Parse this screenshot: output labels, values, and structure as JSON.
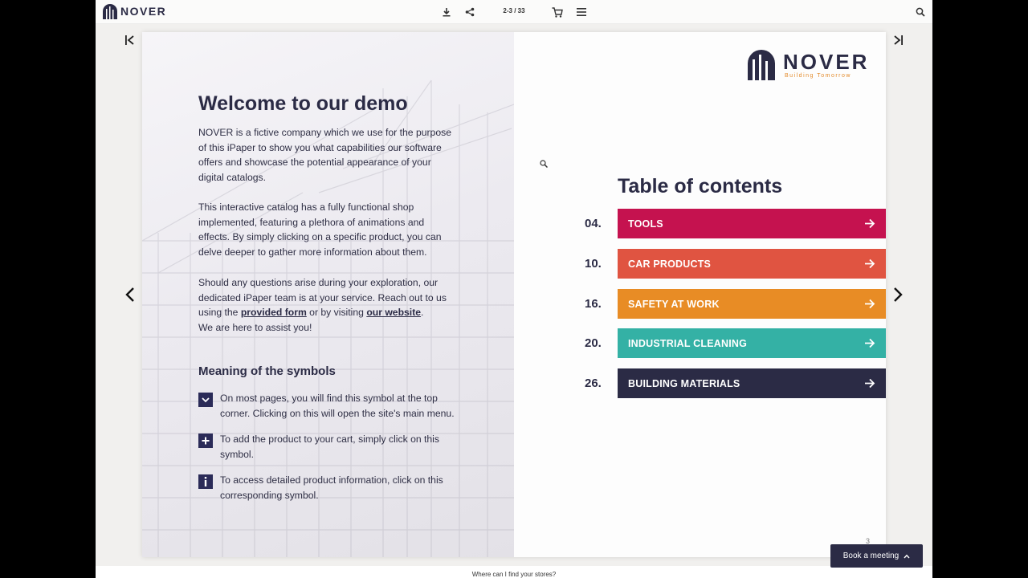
{
  "header": {
    "logo_text": "NOVER",
    "page_indicator": "2-3 / 33"
  },
  "left_page": {
    "title": "Welcome to our demo",
    "para1": "NOVER is a fictive company which we use for the purpose of this iPaper to show you what capabilities our software offers and showcase the potential appearance of your digital catalogs.",
    "para2": "This interactive catalog has a fully functional shop implemented, featuring a plethora of animations and effects. By simply clicking on a specific product, you can delve deeper to gather more information about them.",
    "para3_start": "Should any questions arise during your exploration, our dedicated iPaper team is at your service. Reach out to us using the ",
    "para3_link1": "provided form",
    "para3_mid": " or by visiting ",
    "para3_link2": "our website",
    "para3_end": ".",
    "para3_last": "We are here to assist you!",
    "symbols_title": "Meaning of the symbols",
    "symbols": [
      {
        "icon": "chevron-down-icon",
        "text": "On most pages, you will find this symbol at the top corner. Clicking on this will open the site's main menu."
      },
      {
        "icon": "plus-icon",
        "text": "To add the product to your cart, simply click on this symbol."
      },
      {
        "icon": "info-icon",
        "text": "To access detailed product information, click on this corresponding symbol."
      }
    ]
  },
  "right_page": {
    "logo_text": "NOVER",
    "logo_tagline": "Building Tomorrow",
    "toc_title": "Table of contents",
    "toc": [
      {
        "num": "04.",
        "label": "TOOLS",
        "color": "#c5124f"
      },
      {
        "num": "10.",
        "label": "CAR PRODUCTS",
        "color": "#e05441"
      },
      {
        "num": "16.",
        "label": "SAFETY AT WORK",
        "color": "#e88c25"
      },
      {
        "num": "20.",
        "label": "INDUSTRIAL CLEANING",
        "color": "#34b1a5"
      },
      {
        "num": "26.",
        "label": "BUILDING MATERIALS",
        "color": "#2b2b45"
      }
    ],
    "page_number": "3"
  },
  "footer": {
    "text": "Where can I find your stores?",
    "meeting_button": "Book a meeting"
  },
  "colors": {
    "brand_dark": "#2b2b45",
    "brand_accent": "#e38a2a"
  }
}
